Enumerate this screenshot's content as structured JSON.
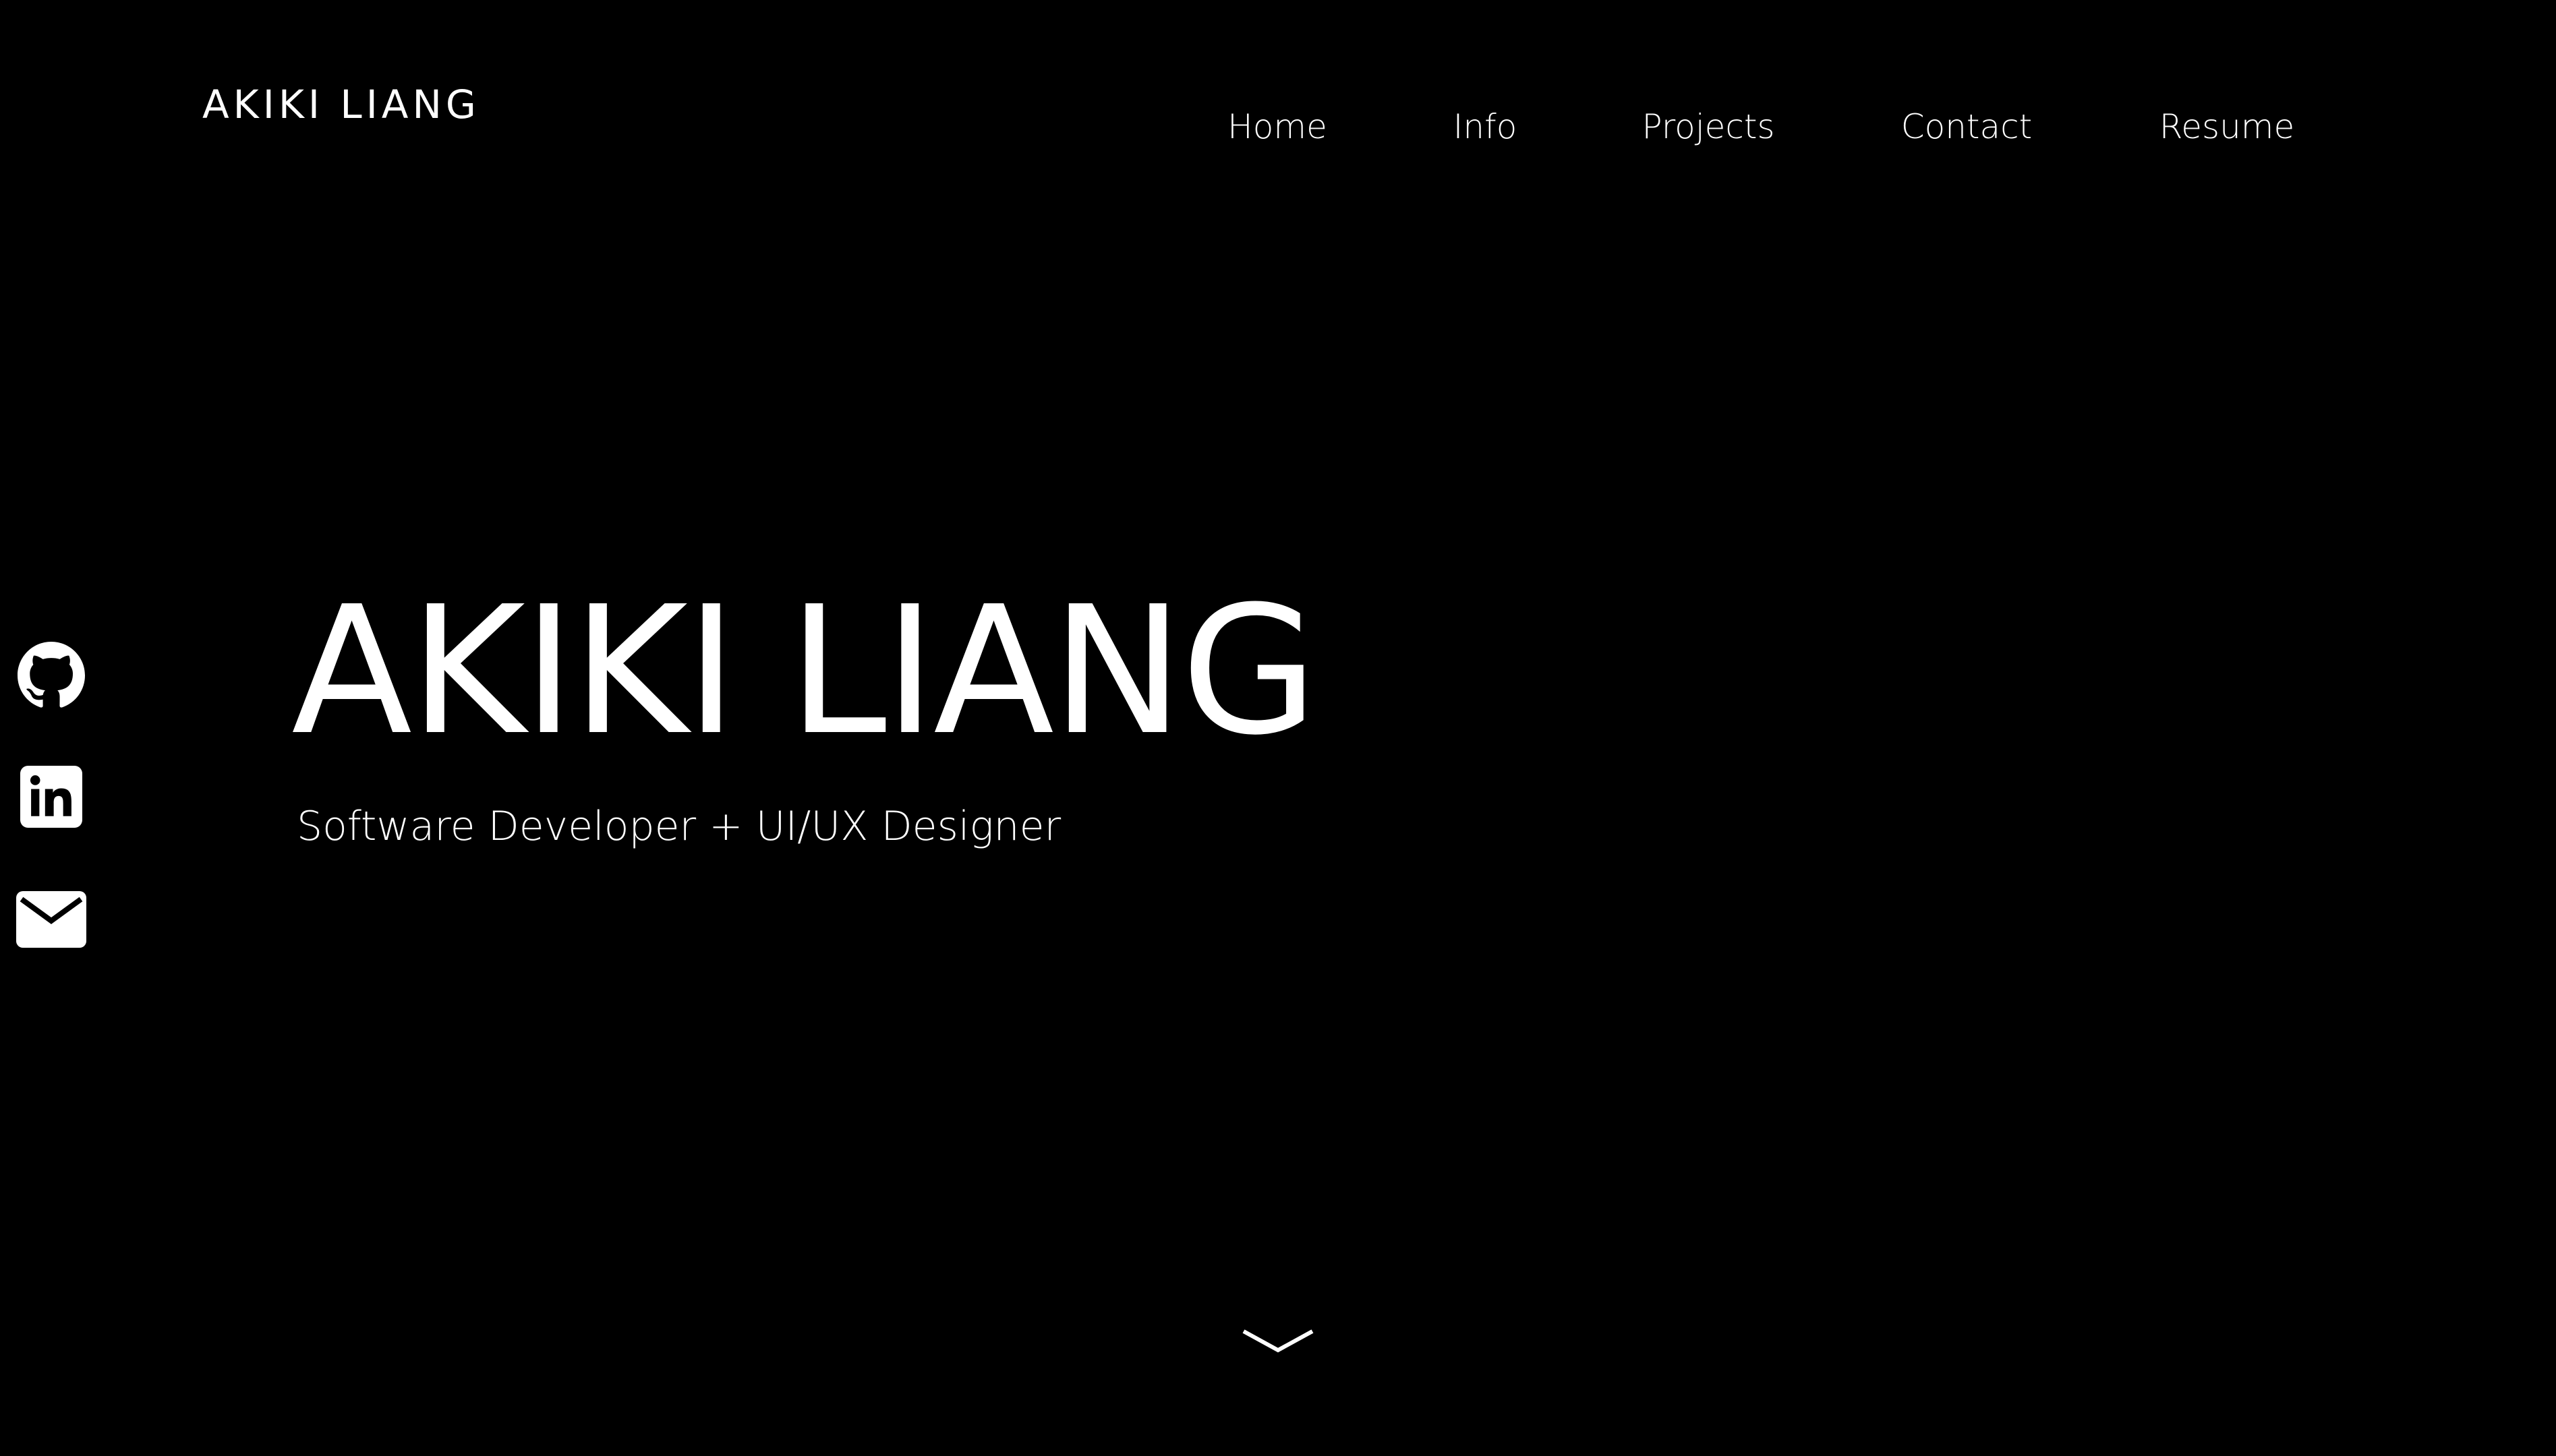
{
  "brand": {
    "name": "AKIKI LIANG"
  },
  "nav": {
    "items": [
      {
        "label": "Home"
      },
      {
        "label": "Info"
      },
      {
        "label": "Projects"
      },
      {
        "label": "Contact"
      },
      {
        "label": "Resume"
      }
    ]
  },
  "hero": {
    "title": "AKIKI LIANG",
    "subtitle": "Software Developer + UI/UX Designer"
  },
  "social": {
    "icons": [
      "github-icon",
      "linkedin-icon",
      "email-icon"
    ]
  },
  "scroll": {
    "icon": "chevron-down-icon"
  },
  "colors": {
    "background": "#000000",
    "text": "#ffffff"
  }
}
